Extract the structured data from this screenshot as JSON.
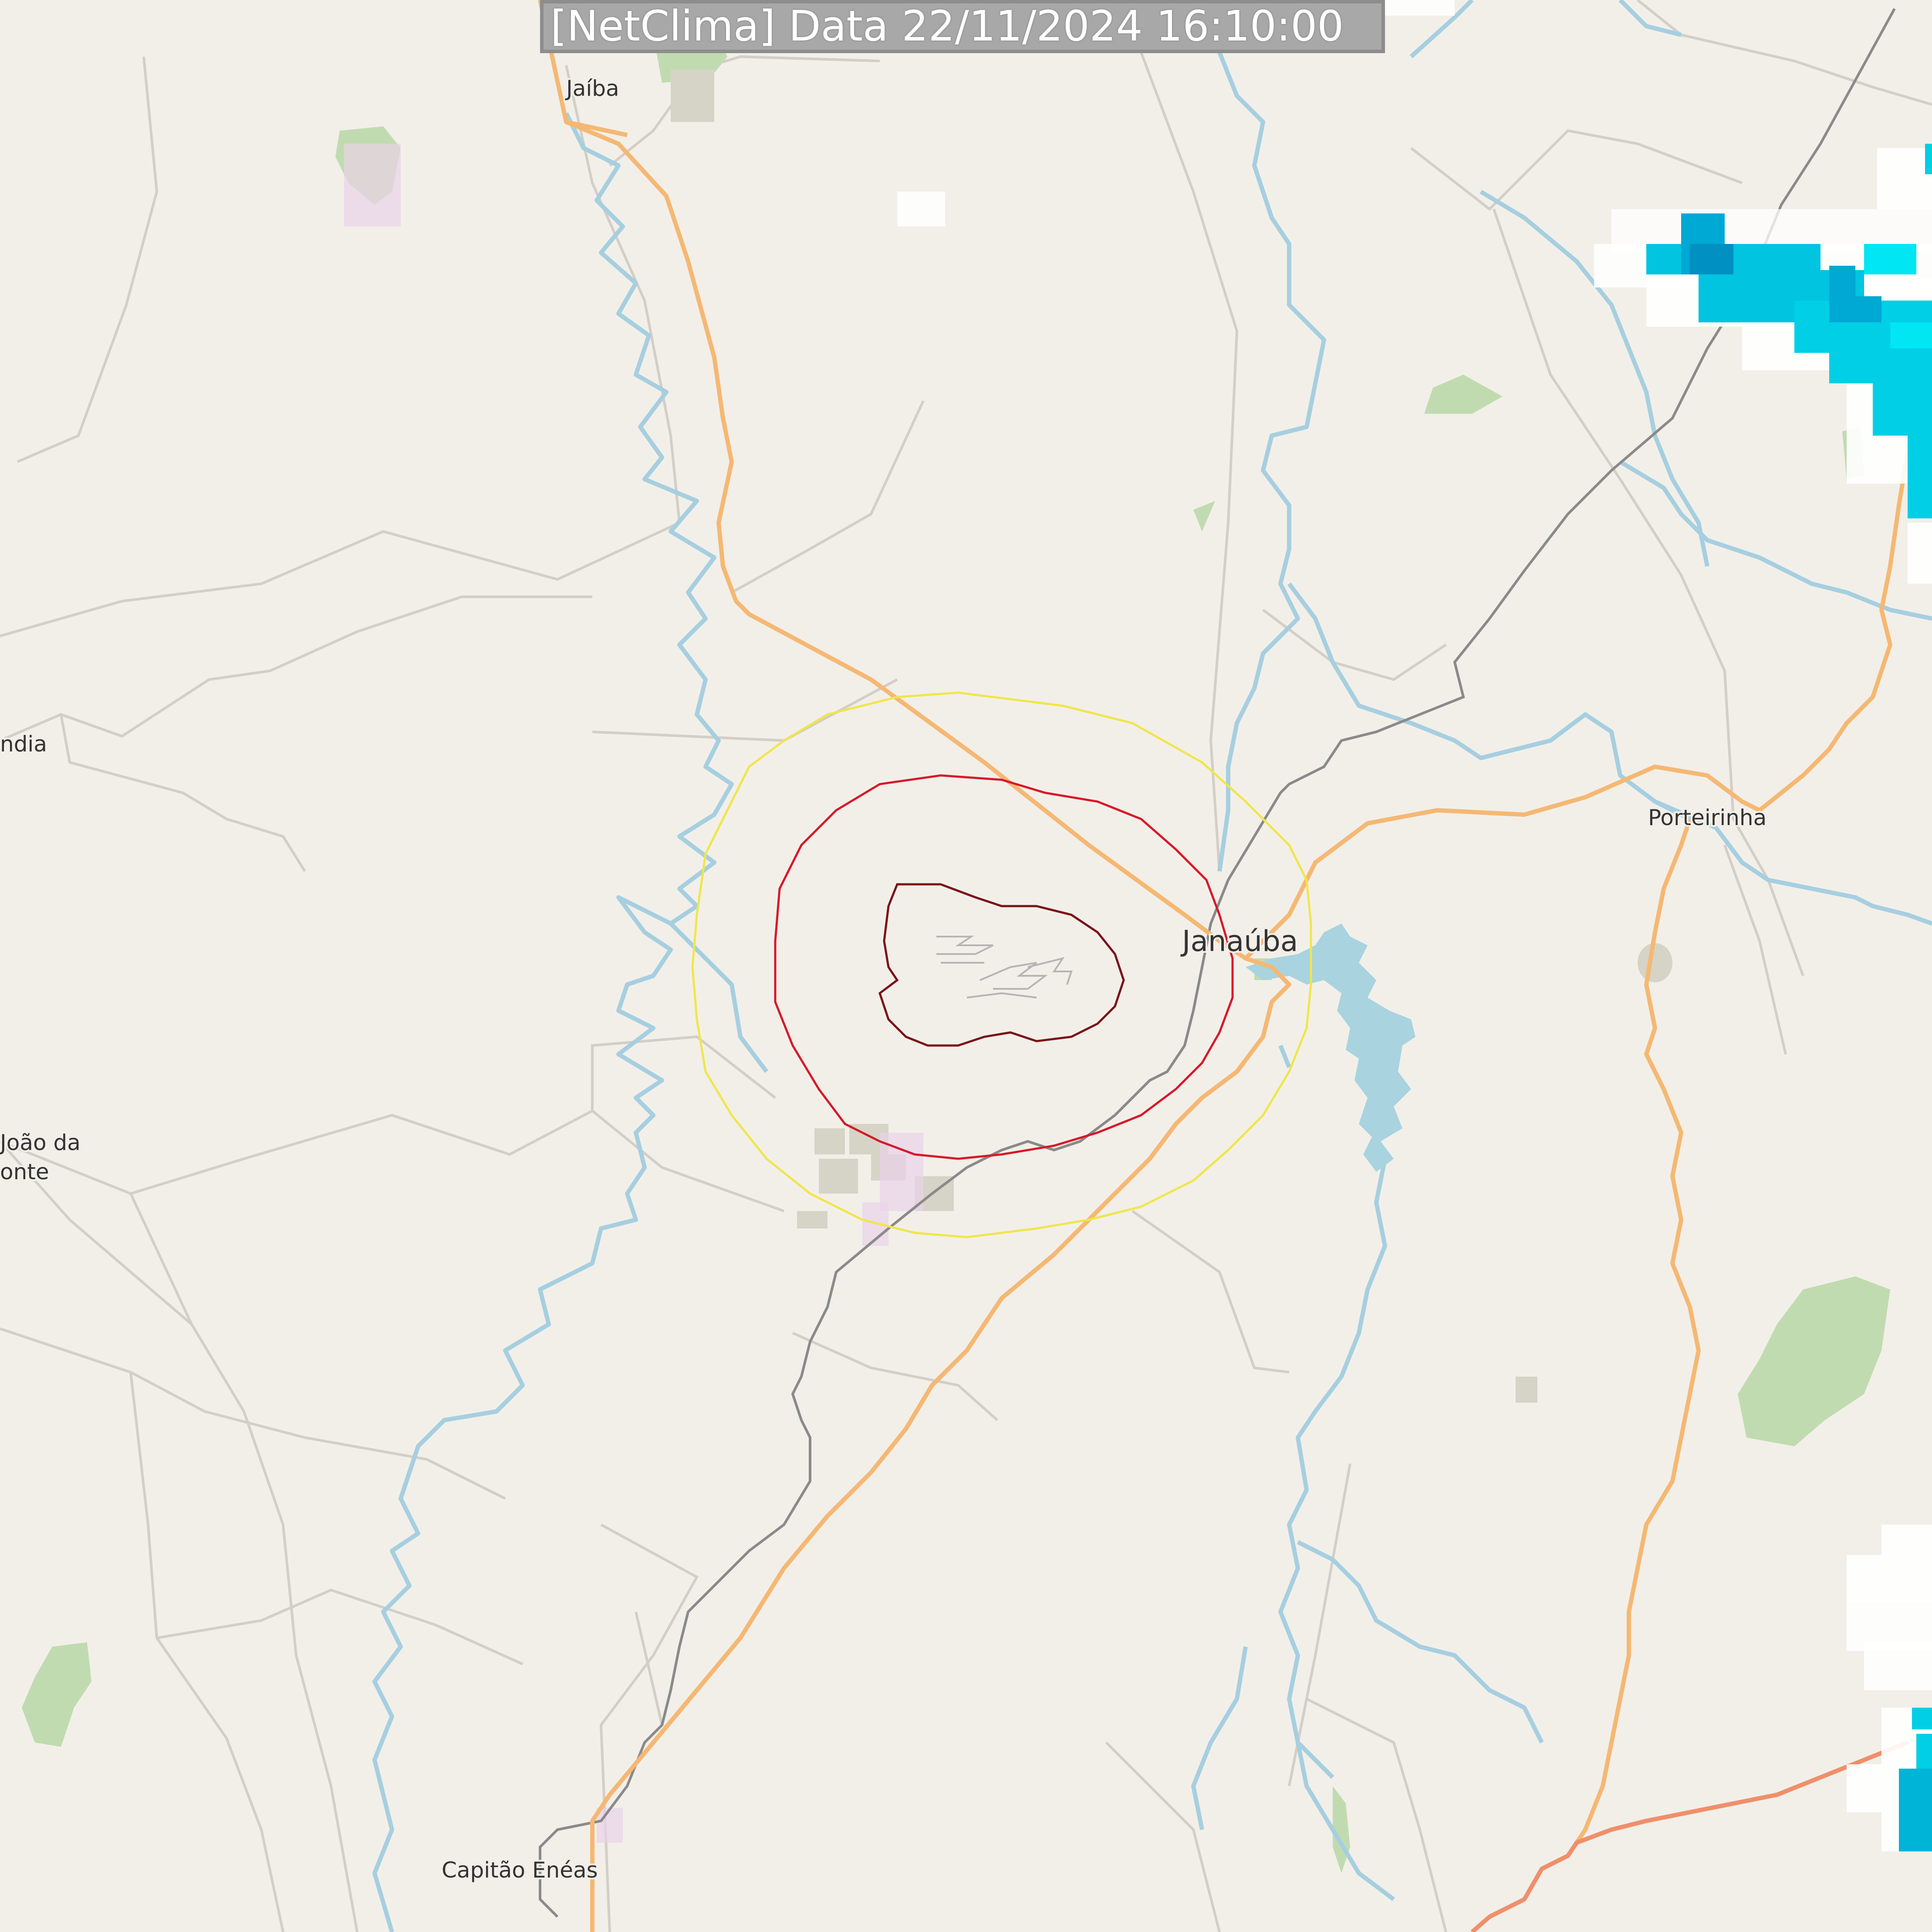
{
  "header": {
    "timestamp": "[NetClima] Data 22/11/2024 16:10:00"
  },
  "places": {
    "jaiba": "Jaíba",
    "janauba": "Janaúba",
    "porteirinha": "Porteirinha",
    "capitao_eneas": "Capitão Enéas",
    "left_edge_1": "ndia",
    "sao_joao_line1": "João da",
    "sao_joao_line2": "onte"
  },
  "colors": {
    "land": "#f2efe9",
    "river": "#a6cfe0",
    "lake": "#a9d3df",
    "road_primary": "#f5b873",
    "road_trunk": "#f08f6a",
    "railway": "#7f7f7f",
    "minor_road": "#cfcac3",
    "forest": "#c1dbb0",
    "urban": "#d6d3c7",
    "residential": "#e9d3e8",
    "range_ring_outer": "#f0e64a",
    "range_ring_middle": "#d7192a",
    "range_ring_inner": "#7a1218",
    "radar_light": "#00d6e9",
    "radar_mid": "#00b4d8",
    "radar_dark": "#0090c2",
    "radar_faint": "#ffffff"
  }
}
